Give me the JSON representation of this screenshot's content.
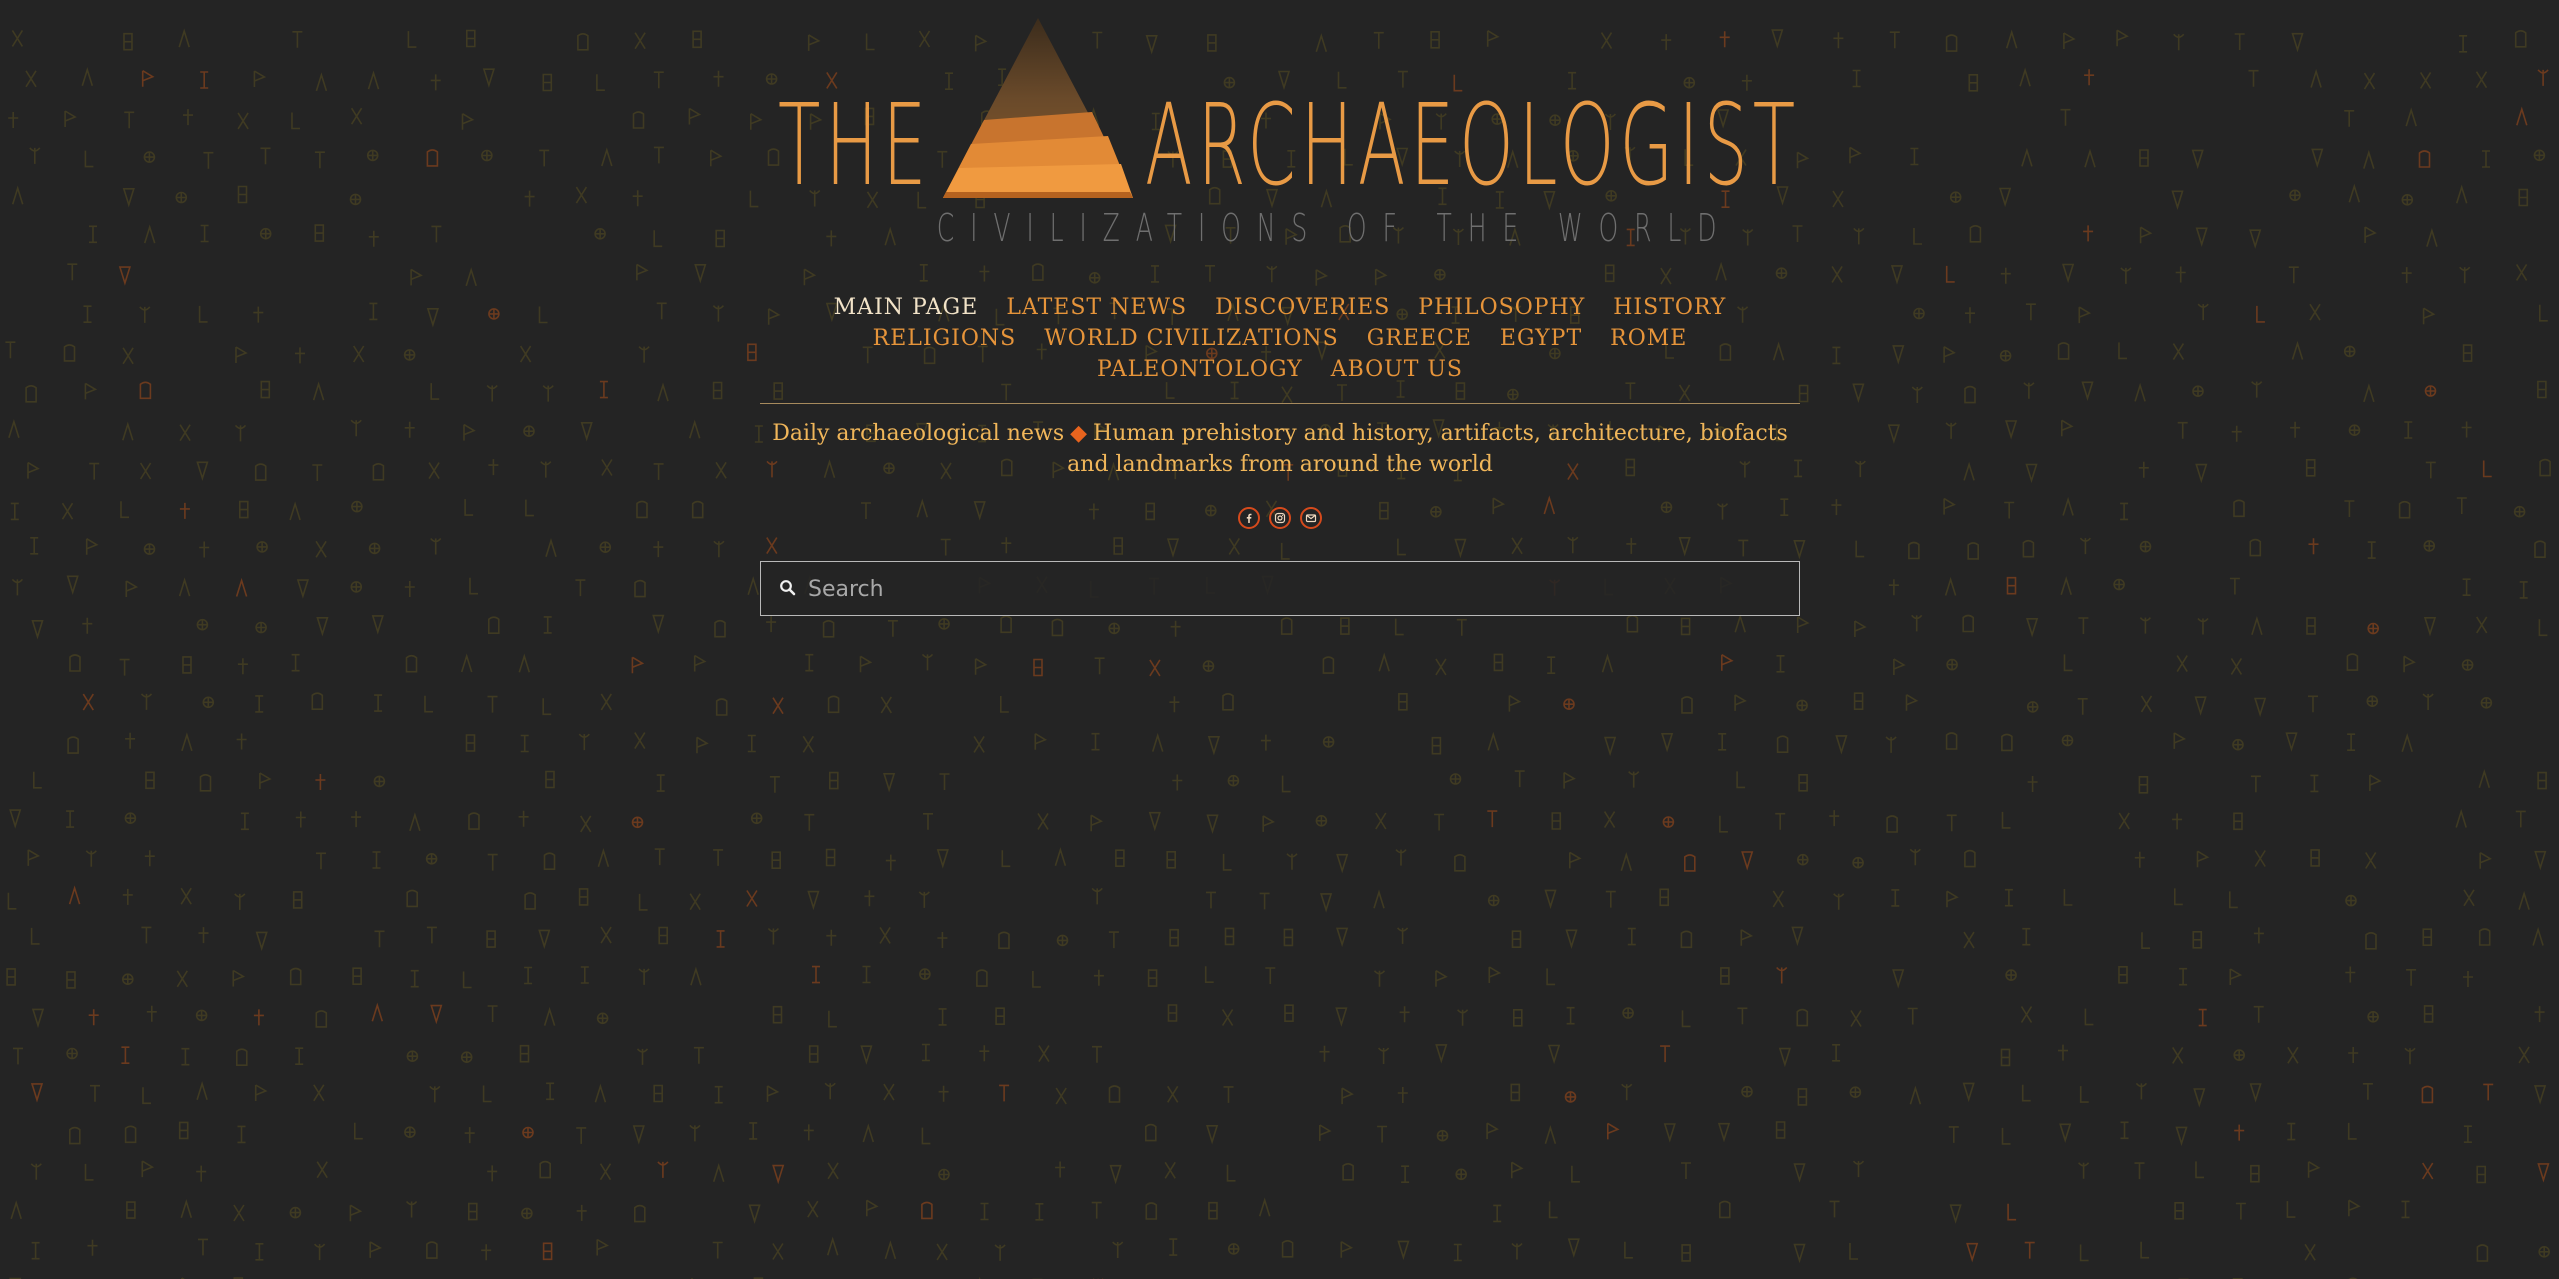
{
  "logo": {
    "word_left": "THE",
    "word_right": "ARCHAEOLOGIST",
    "tagline": "CIVILIZATIONS OF THE WORLD"
  },
  "nav": {
    "rows": [
      [
        "MAIN PAGE",
        "LATEST NEWS",
        "DISCOVERIES",
        "PHILOSOPHY",
        "HISTORY"
      ],
      [
        "RELIGIONS",
        "WORLD CIVILIZATIONS",
        "GREECE",
        "EGYPT",
        "ROME"
      ],
      [
        "PALEONTOLOGY",
        "ABOUT US"
      ]
    ],
    "active": "MAIN PAGE"
  },
  "description": {
    "left": "Daily archaeological news",
    "separator": "◆",
    "right": "Human prehistory and history, artifacts, architecture, biofacts and landmarks from around the world"
  },
  "social": [
    {
      "name": "facebook-icon"
    },
    {
      "name": "instagram-icon"
    },
    {
      "name": "email-icon"
    }
  ],
  "search": {
    "placeholder": "Search",
    "value": ""
  },
  "colors": {
    "background": "#242424",
    "accent": "#e6943a",
    "active_nav": "#f2e3c8",
    "description": "#f0b65a",
    "social_ring": "#d64a1c",
    "glyphs": "#3f3a22"
  }
}
